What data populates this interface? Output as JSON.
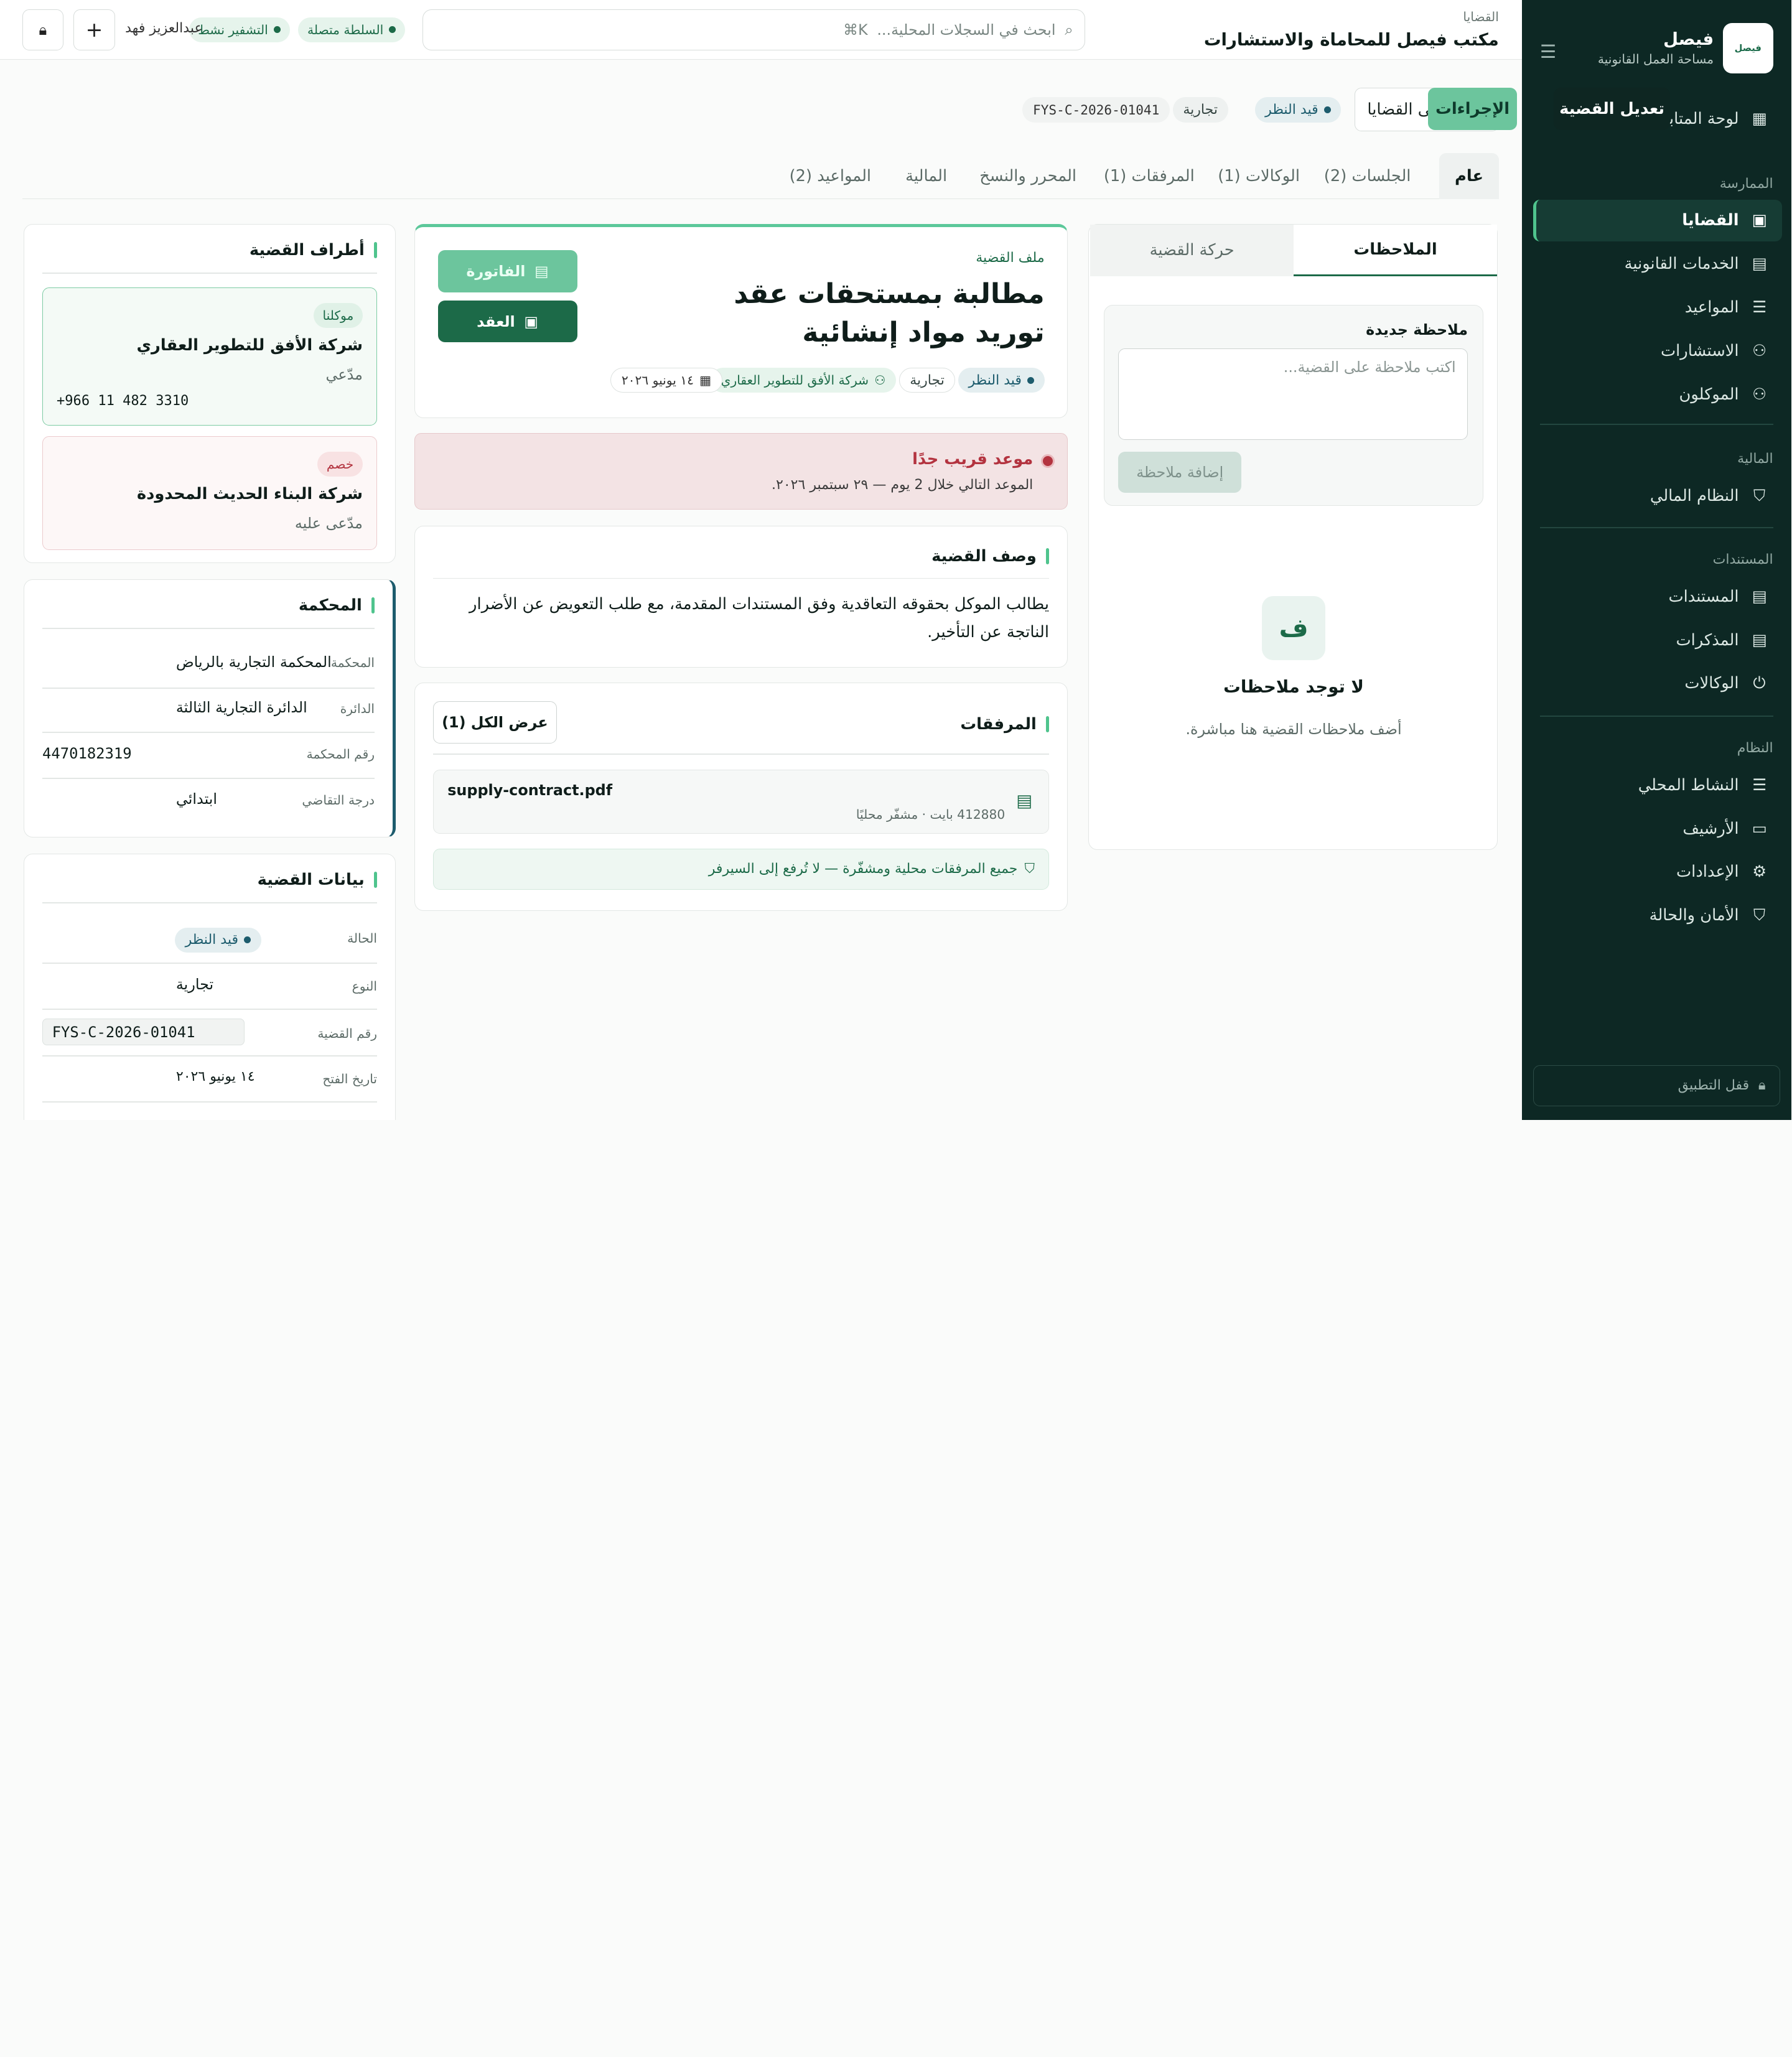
{
  "sidebar": {
    "brand_name": "فيصل",
    "brand_sub": "مساحة العمل القانونية",
    "logo_text": "فيصل",
    "items": [
      {
        "label": "لوحة المتابعة",
        "icon": "dashboard-icon"
      },
      {
        "label": "القضايا",
        "icon": "briefcase-icon"
      },
      {
        "label": "الخدمات القانونية",
        "icon": "document-icon"
      },
      {
        "label": "المواعيد",
        "icon": "list-icon"
      },
      {
        "label": "الاستشارات",
        "icon": "users-icon"
      },
      {
        "label": "الموكلون",
        "icon": "users-icon"
      },
      {
        "label": "النظام المالي",
        "icon": "shield-icon"
      },
      {
        "label": "المستندات",
        "icon": "document-icon"
      },
      {
        "label": "المذكرات",
        "icon": "document-icon"
      },
      {
        "label": "الوكالات",
        "icon": "power-icon"
      },
      {
        "label": "النشاط المحلي",
        "icon": "list-icon"
      },
      {
        "label": "الأرشيف",
        "icon": "archive-icon"
      },
      {
        "label": "الإعدادات",
        "icon": "gear-icon"
      },
      {
        "label": "الأمان والحالة",
        "icon": "shield-icon"
      }
    ],
    "sections": [
      "الممارسة",
      "المالية",
      "المستندات",
      "النظام"
    ],
    "lock_label": "قفل التطبيق"
  },
  "topbar": {
    "breadcrumb": "القضايا",
    "title": "مكتب فيصل للمحاماة والاستشارات",
    "search_placeholder": "ابحث في السجلات المحلية...",
    "search_shortcut": "⌘K",
    "chip_authority": "السلطة متصلة",
    "chip_encryption": "التشفير نشط",
    "user": "عبدالعزيز فهد"
  },
  "header": {
    "back": "العودة إلى القضايا",
    "status": "قيد النظر",
    "type": "تجارية",
    "code": "FYS-C-2026-01041",
    "edit": "تعديل القضية",
    "actions": "الإجراءات"
  },
  "tabs": [
    "عام",
    "الجلسات (2)",
    "الوكالات (1)",
    "المرفقات (1)",
    "المحرر والنسخ",
    "المالية",
    "المواعيد (2)"
  ],
  "notes": {
    "tab_notes": "الملاحظات",
    "tab_movement": "حركة القضية",
    "new_label": "ملاحظة جديدة",
    "placeholder": "اكتب ملاحظة على القضية...",
    "add_btn": "إضافة ملاحظة",
    "empty_icon": "ف",
    "empty_title": "لا توجد ملاحظات",
    "empty_sub": "أضف ملاحظات القضية هنا مباشرة."
  },
  "case": {
    "kicker": "ملف القضية",
    "title": "مطالبة بمستحقات عقد توريد مواد إنشائية",
    "status": "قيد النظر",
    "type": "تجارية",
    "client": "شركة الأفق للتطوير العقاري",
    "date": "١٤ يونيو ٢٠٢٦",
    "invoice_btn": "الفاتورة",
    "contract_btn": "العقد"
  },
  "alert": {
    "title": "موعد قريب جدًا",
    "text": "الموعد التالي خلال 2 يوم — ٢٩ سبتمبر ٢٠٢٦."
  },
  "description": {
    "title": "وصف القضية",
    "text": "يطالب الموكل بحقوقه التعاقدية وفق المستندات المقدمة، مع طلب التعويض عن الأضرار الناتجة عن التأخير."
  },
  "attachments": {
    "title": "المرفقات",
    "view_all": "عرض الكل (1)",
    "file_name": "supply-contract.pdf",
    "file_meta": "412880 بايت · مشفّر محليًا",
    "footer": "جميع المرفقات محلية ومشفّرة — لا تُرفع إلى السيرفر"
  },
  "parties": {
    "title": "أطراف القضية",
    "p1_badge": "موكلنا",
    "p1_name": "شركة الأفق للتطوير العقاري",
    "p1_role": "مدّعي",
    "p1_phone": "+966 11 482 3310",
    "p2_badge": "خصم",
    "p2_name": "شركة البناء الحديث المحدودة",
    "p2_role": "مدّعى عليه"
  },
  "court": {
    "title": "المحكمة",
    "rows": [
      {
        "label": "المحكمة",
        "value": "المحكمة التجارية بالرياض"
      },
      {
        "label": "الدائرة",
        "value": "الدائرة التجارية الثالثة"
      },
      {
        "label": "رقم المحكمة",
        "value": "4470182319"
      },
      {
        "label": "درجة التقاضي",
        "value": "ابتدائي"
      }
    ]
  },
  "casedata": {
    "title": "بيانات القضية",
    "status_label": "الحالة",
    "status": "قيد النظر",
    "type_label": "النوع",
    "type": "تجارية",
    "code_label": "رقم القضية",
    "code": "FYS-C-2026-01041",
    "opened_label": "تاريخ الفتح",
    "opened": "١٤ يونيو ٢٠٢٦"
  },
  "colors": {
    "sidebar": "#0d2824",
    "accent": "#1c6a48",
    "alert": "#b3333f"
  }
}
